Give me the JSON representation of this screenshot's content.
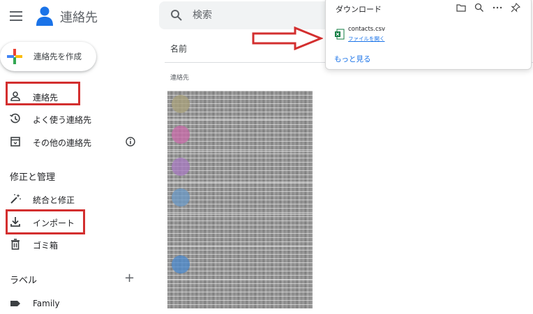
{
  "app": {
    "title": "連絡先"
  },
  "search": {
    "placeholder": "検索"
  },
  "create_button": {
    "label": "連絡先を作成"
  },
  "sidebar": {
    "items": [
      {
        "label": "連絡先",
        "icon": "person-icon"
      },
      {
        "label": "よく使う連絡先",
        "icon": "history-icon"
      },
      {
        "label": "その他の連絡先",
        "icon": "archive-icon"
      }
    ],
    "manage_title": "修正と管理",
    "manage_items": [
      {
        "label": "統合と修正",
        "icon": "magic-wand-icon"
      },
      {
        "label": "インポート",
        "icon": "download-icon"
      },
      {
        "label": "ゴミ箱",
        "icon": "trash-icon"
      }
    ],
    "labels_title": "ラベル",
    "label_items": [
      {
        "label": "Family",
        "icon": "label-icon"
      }
    ],
    "add_label": "+"
  },
  "main": {
    "column_header": "名前",
    "section_label": "連絡先"
  },
  "downloads": {
    "title": "ダウンロード",
    "file_name": "contacts.csv",
    "open_link": "ファイルを開く",
    "more_link": "もっと見る",
    "tools": [
      "folder-icon",
      "search-icon",
      "more-icon",
      "pin-icon"
    ]
  },
  "colors": {
    "annotation_red": "#d32f2f",
    "link_blue": "#1a73e8"
  }
}
